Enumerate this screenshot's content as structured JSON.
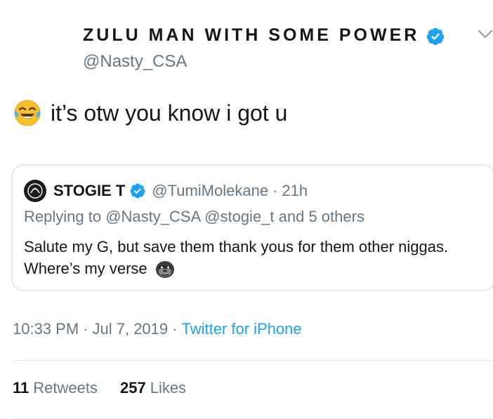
{
  "author": {
    "display_name": "ZULU MAN WITH SOME POWER",
    "handle": "@Nasty_CSA",
    "verified": true
  },
  "tweet": {
    "emoji": "face-with-tears-of-joy",
    "text": "it’s otw you know i got u"
  },
  "quoted_tweet": {
    "display_name": "STOGIE T",
    "handle": "@TumiMolekane",
    "separator": "·",
    "time_ago": "21h",
    "replying_label": "Replying to",
    "replying_to": "@Nasty_CSA @stogie_t and 5 others",
    "text": "Salute my G, but save them thank yous for them other niggas. Where’s my verse",
    "emoji": "gorilla"
  },
  "meta": {
    "time": "10:33 PM",
    "separator": "·",
    "date": "Jul 7, 2019",
    "source": "Twitter for iPhone"
  },
  "stats": {
    "retweets_count": "11",
    "retweets_label": "Retweets",
    "likes_count": "257",
    "likes_label": "Likes"
  },
  "colors": {
    "accent": "#1da1f2",
    "muted": "#657786",
    "border": "#e1e8ed",
    "text": "#14171a"
  }
}
